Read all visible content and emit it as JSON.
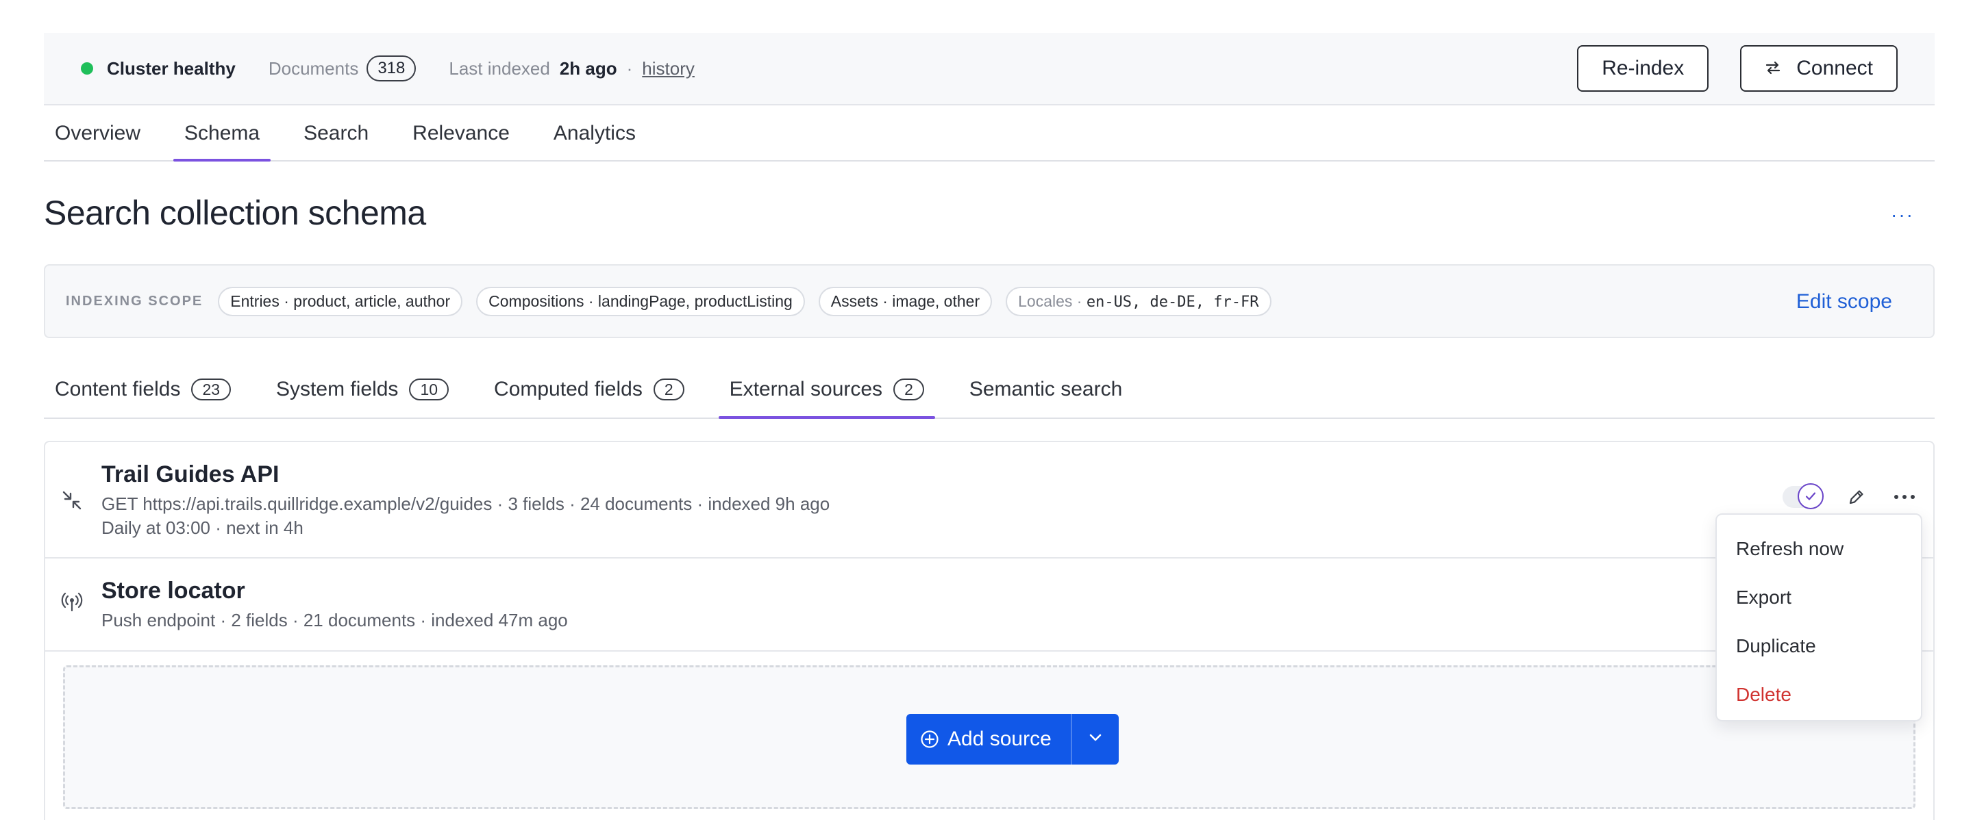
{
  "status": {
    "health_label": "Cluster healthy",
    "health_color": "#1fbf5a",
    "documents_label": "Documents",
    "documents_count": "318",
    "last_indexed_label": "Last indexed",
    "last_indexed_value": "2h ago",
    "separator": "·",
    "history_link": "history",
    "reindex_label": "Re-index",
    "connect_label": "Connect"
  },
  "tabs": [
    "Overview",
    "Schema",
    "Search",
    "Relevance",
    "Analytics"
  ],
  "active_tab": "Schema",
  "page_title": "Search collection schema",
  "more_label": "···",
  "scope": {
    "label": "INDEXING SCOPE",
    "chips": [
      "Entries · product, article, author",
      "Compositions · landingPage, productListing",
      "Assets · image, other"
    ],
    "locales_label": "Locales ·",
    "locales_value": "en-US, de-DE, fr-FR",
    "edit_label": "Edit scope"
  },
  "subtabs": [
    {
      "label": "Content fields",
      "count": "23"
    },
    {
      "label": "System fields",
      "count": "10"
    },
    {
      "label": "Computed fields",
      "count": "2"
    },
    {
      "label": "External sources",
      "count": "2"
    },
    {
      "label": "Semantic search",
      "count": ""
    }
  ],
  "active_subtab": "External sources",
  "sources": [
    {
      "name": "Trail Guides API",
      "line1": "GET https://api.trails.quillridge.example/v2/guides · 3 fields · 24 documents · indexed 9h ago",
      "line2": "Daily at 03:00 · next in 4h",
      "icon": "collapse-arrows-icon"
    },
    {
      "name": "Store locator",
      "line1": "Push endpoint · 2 fields · 21 documents · indexed 47m ago",
      "icon": "broadcast-icon"
    }
  ],
  "add_source_label": "Add source",
  "menu": {
    "items": [
      "Refresh now",
      "Export",
      "Duplicate",
      "Delete"
    ]
  },
  "colors": {
    "accent": "#7b52e0",
    "primary": "#1158e8",
    "link": "#1f5fd6",
    "danger": "#d0322f"
  }
}
